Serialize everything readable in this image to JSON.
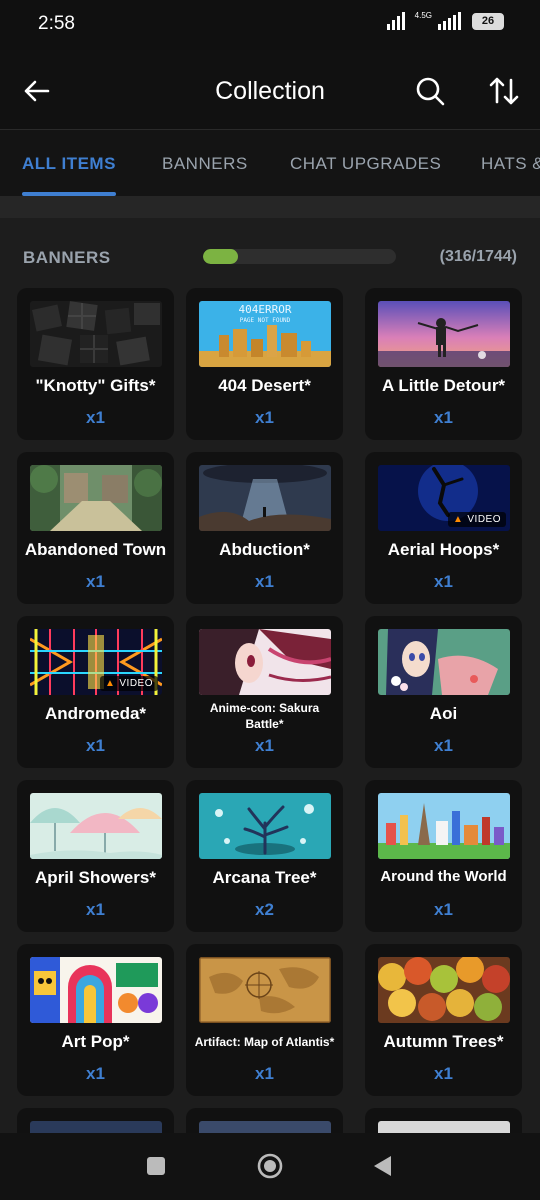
{
  "status": {
    "time": "2:58",
    "network": "4.5G",
    "battery": "26"
  },
  "header": {
    "title": "Collection"
  },
  "tabs": [
    {
      "label": "ALL ITEMS",
      "active": true
    },
    {
      "label": "BANNERS",
      "active": false
    },
    {
      "label": "CHAT UPGRADES",
      "active": false
    },
    {
      "label": "HATS &",
      "active": false
    }
  ],
  "section": {
    "title": "BANNERS",
    "count": "(316/1744)",
    "progress": 0.181
  },
  "items": [
    {
      "name": "\"Knotty\" Gifts*",
      "count": "x1",
      "thumb": "dark-gift-boxes"
    },
    {
      "name": "404 Desert*",
      "count": "x1",
      "thumb": "pixel-desert-404",
      "thumb_text": "404ERROR",
      "thumb_sub": "PAGE NOT FOUND"
    },
    {
      "name": "A Little Detour*",
      "count": "x1",
      "thumb": "girl-sunset-sky"
    },
    {
      "name": "Abandoned Town",
      "count": "x1",
      "thumb": "overgrown-town"
    },
    {
      "name": "Abduction*",
      "count": "x1",
      "thumb": "ufo-beam"
    },
    {
      "name": "Aerial Hoops*",
      "count": "x1",
      "thumb": "blue-acrobat",
      "video": "VIDEO"
    },
    {
      "name": "Andromeda*",
      "count": "x1",
      "thumb": "neon-grid",
      "video": "VIDEO"
    },
    {
      "name": "Anime-con: Sakura Battle*",
      "count": "x1",
      "thumb": "anime-girl-pink"
    },
    {
      "name": "Aoi",
      "count": "x1",
      "thumb": "anime-girl-flowers"
    },
    {
      "name": "April Showers*",
      "count": "x1",
      "thumb": "pastel-umbrellas"
    },
    {
      "name": "Arcana Tree*",
      "count": "x2",
      "thumb": "mystic-tree"
    },
    {
      "name": "Around the World",
      "count": "x1",
      "thumb": "world-landmarks"
    },
    {
      "name": "Art Pop*",
      "count": "x1",
      "thumb": "pop-art"
    },
    {
      "name": "Artifact: Map of Atlantis*",
      "count": "x1",
      "thumb": "ancient-map"
    },
    {
      "name": "Autumn Trees*",
      "count": "x1",
      "thumb": "autumn-trees"
    }
  ],
  "icons": {
    "back": "back-arrow-icon",
    "search": "search-icon",
    "sort": "sort-icon",
    "flame": "flame-icon"
  },
  "colors": {
    "accent": "#3f7fd1",
    "progress": "#7cb342",
    "card_bg": "#111111"
  }
}
